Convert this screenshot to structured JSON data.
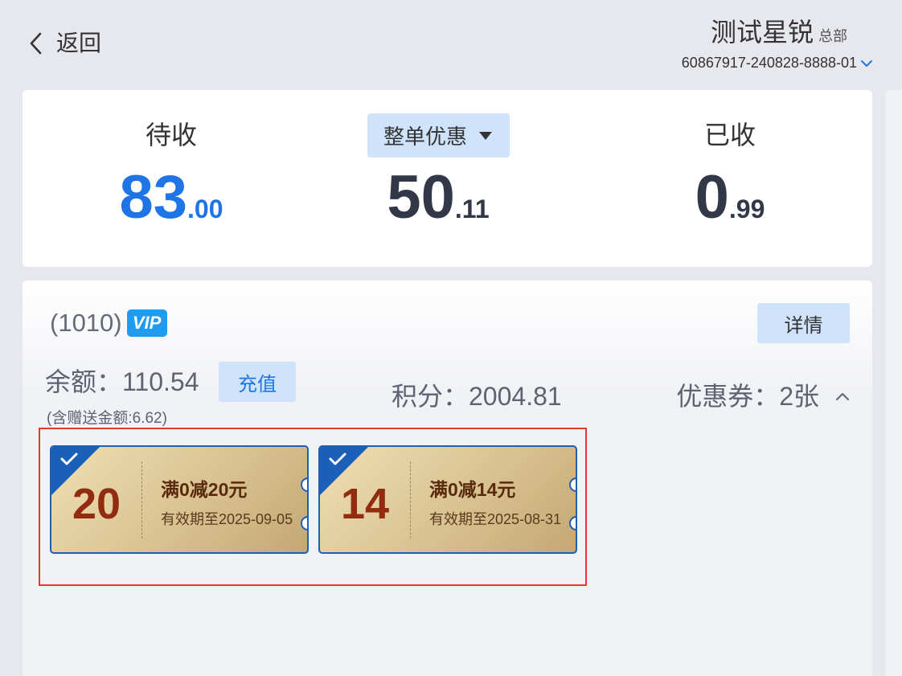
{
  "header": {
    "back_label": "返回",
    "store_name": "测试星锐",
    "store_tag": "总部",
    "account_no": "60867917-240828-8888-01"
  },
  "summary": {
    "pending_title": "待收",
    "pending_int": "83",
    "pending_dec": ".00",
    "discount_label": "整单优惠",
    "discount_int": "50",
    "discount_dec": ".11",
    "received_title": "已收",
    "received_int": "0",
    "received_dec": ".99"
  },
  "member": {
    "code": "(1010)",
    "vip_badge": "VIP",
    "detail_label": "详情",
    "balance": "余额：110.54",
    "recharge_label": "充值",
    "gift_amount": "(含赠送金额:6.62)",
    "points": "积分：2004.81",
    "coupons": "优惠券：2张"
  },
  "coupons": [
    {
      "value": "20",
      "title": "满0减20元",
      "expiry": "有效期至2025-09-05",
      "selected": true
    },
    {
      "value": "14",
      "title": "满0减14元",
      "expiry": "有效期至2025-08-31",
      "selected": true
    }
  ],
  "colors": {
    "accent_blue": "#1f74e6",
    "button_bg": "#cfe3fb",
    "highlight_border": "#e8372c",
    "coupon_border": "#1f5fb5",
    "coupon_value": "#922b0f"
  }
}
